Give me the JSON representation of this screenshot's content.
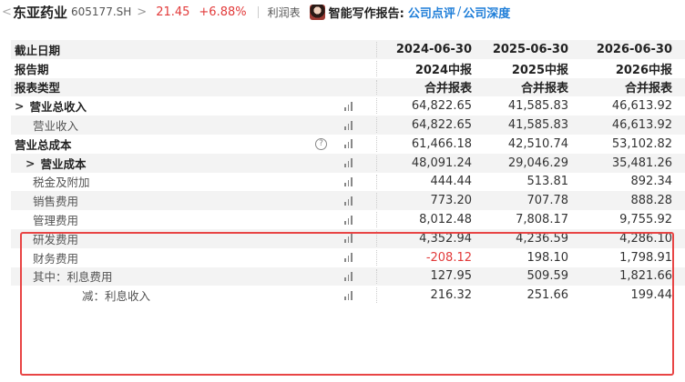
{
  "header": {
    "back_chevron": "<",
    "stock_name": "东亚药业",
    "stock_code": "605177.SH",
    "code_chevron": ">",
    "price": "21.45",
    "change": "+6.88%",
    "report_type": "利润表",
    "writer_label": "智能写作报告:",
    "link_review": "公司点评",
    "link_sep": "/",
    "link_depth": "公司深度"
  },
  "table": {
    "header_rows": [
      {
        "label": "截止日期",
        "values": [
          "2024-06-30",
          "2025-06-30",
          "2026-06-30"
        ]
      },
      {
        "label": "报告期",
        "values": [
          "2024中报",
          "2025中报",
          "2026中报"
        ]
      },
      {
        "label": "报表类型",
        "values": [
          "合并报表",
          "合并报表",
          "合并报表"
        ]
      }
    ],
    "rows": [
      {
        "label": "营业总收入",
        "chevron": ">",
        "values": [
          "64,822.65",
          "41,585.83",
          "46,613.92"
        ]
      },
      {
        "label": "营业收入",
        "values": [
          "64,822.65",
          "41,585.83",
          "46,613.92"
        ]
      },
      {
        "label": "营业总成本",
        "values": [
          "61,466.18",
          "42,510.74",
          "53,102.82"
        ]
      },
      {
        "label": "营业成本",
        "chevron": ">",
        "values": [
          "48,091.24",
          "29,046.29",
          "35,481.26"
        ]
      },
      {
        "label": "税金及附加",
        "values": [
          "444.44",
          "513.81",
          "892.34"
        ]
      },
      {
        "label": "销售费用",
        "values": [
          "773.20",
          "707.78",
          "888.28"
        ]
      },
      {
        "label": "管理费用",
        "values": [
          "8,012.48",
          "7,808.17",
          "9,755.92"
        ]
      },
      {
        "label": "研发费用",
        "values": [
          "4,352.94",
          "4,236.59",
          "4,286.10"
        ]
      },
      {
        "label": "财务费用",
        "values": [
          "-208.12",
          "198.10",
          "1,798.91"
        ]
      },
      {
        "label": "其中：利息费用",
        "values": [
          "127.95",
          "509.59",
          "1,821.66"
        ]
      },
      {
        "label": "减：利息收入",
        "values": [
          "216.32",
          "251.66",
          "199.44"
        ]
      }
    ],
    "help_icon": "?"
  },
  "colors": {
    "up": "#e23a3a",
    "link": "#1f7ed8",
    "highlight": "#e84545",
    "row_alt": "#f3f3f3"
  },
  "icons": [
    "bar-chart-icon",
    "help-circle-icon",
    "avatar",
    "chevron-right-icon",
    "chevron-left-icon"
  ]
}
